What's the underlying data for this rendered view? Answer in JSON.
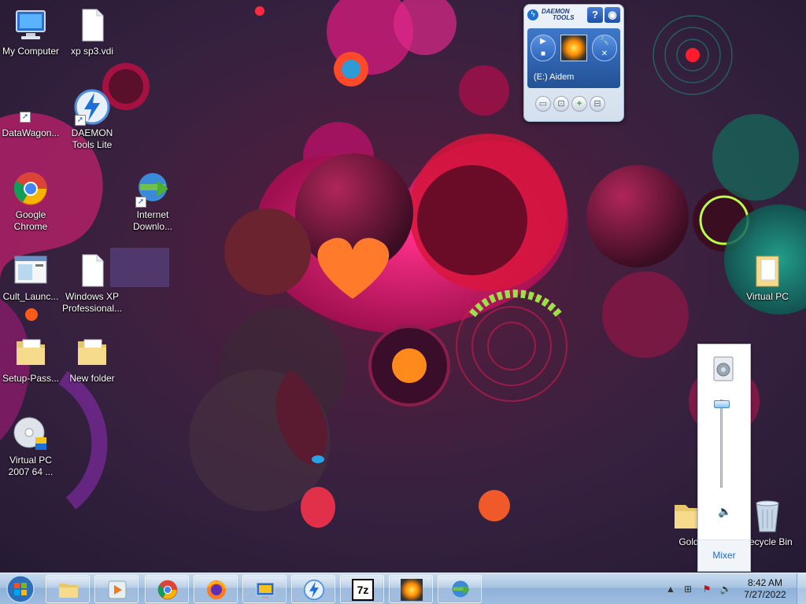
{
  "desktop": {
    "icons": [
      {
        "label": "My Computer",
        "icon": "computer-icon"
      },
      {
        "label": "xp sp3.vdi",
        "icon": "file-icon"
      },
      {
        "label": "DataWagon...",
        "icon": "shortcut-icon"
      },
      {
        "label": "DAEMON Tools Lite",
        "icon": "daemon-tools-icon"
      },
      {
        "label": "Google Chrome",
        "icon": "chrome-icon"
      },
      {
        "label": "Internet Downlo...",
        "icon": "internet-download-manager-icon"
      },
      {
        "label": "Cult_Launc...",
        "icon": "window-icon"
      },
      {
        "label": "Windows XP Professional...",
        "icon": "file-icon"
      },
      {
        "label": "Setup-Pass...",
        "icon": "folder-icon"
      },
      {
        "label": "New folder",
        "icon": "folder-icon"
      },
      {
        "label": "Virtual PC 2007 64 ...",
        "icon": "installer-icon"
      },
      {
        "label": "Virtual PC",
        "icon": "folder-icon"
      },
      {
        "label": "Gold",
        "icon": "folder-icon"
      },
      {
        "label": "Recycle Bin",
        "icon": "recycle-bin-icon"
      }
    ]
  },
  "daemon_gadget": {
    "logo_line1": "DAEMON",
    "logo_line2": "TOOLS",
    "help_label": "?",
    "drive_label": "(E:) Aidem"
  },
  "volume_mixer": {
    "level": 0.95,
    "mixer_link": "Mixer"
  },
  "taskbar": {
    "buttons": [
      {
        "name": "windows-explorer",
        "icon": "folder-icon"
      },
      {
        "name": "media-player",
        "icon": "media-player-icon"
      },
      {
        "name": "google-chrome",
        "icon": "chrome-icon"
      },
      {
        "name": "firefox",
        "icon": "firefox-icon"
      },
      {
        "name": "virtual-pc",
        "icon": "virtual-pc-icon"
      },
      {
        "name": "daemon-tools",
        "icon": "daemon-tools-icon"
      },
      {
        "name": "7-zip",
        "icon": "7zip-icon"
      },
      {
        "name": "daemon-tools-gadget",
        "icon": "disc-image-icon"
      },
      {
        "name": "internet-download-manager",
        "icon": "internet-download-manager-icon"
      }
    ],
    "zip_label": "7z",
    "clock_time": "8:42 AM",
    "clock_date": "7/27/2022"
  }
}
